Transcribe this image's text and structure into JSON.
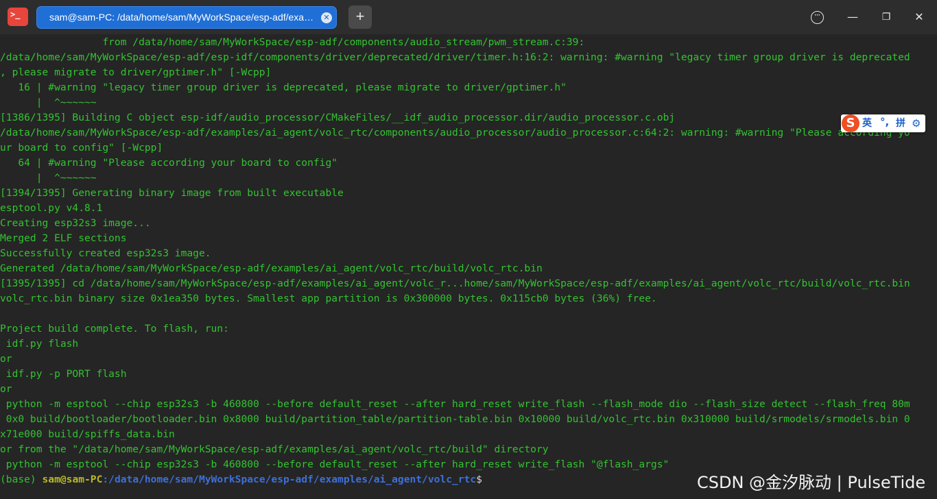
{
  "window": {
    "tab_title": "sam@sam-PC: /data/home/sam/MyWorkSpace/esp-adf/exa…",
    "app_icon_text": ">_",
    "new_tab_label": "+",
    "more_label": "···",
    "minimize_label": "—",
    "maximize_label": "❐",
    "close_label": "✕",
    "icons": {
      "app": "terminal-icon",
      "tab_close": "close-icon",
      "new_tab": "plus-icon",
      "more": "more-icon",
      "minimize": "minimize-icon",
      "maximize": "maximize-icon",
      "close": "close-icon"
    },
    "colors": {
      "tab": "#1f6fd6",
      "terminal_text": "#33c331",
      "prompt_user": "#b7b928",
      "prompt_path": "#3d6fd9"
    }
  },
  "terminal": {
    "lines": [
      "                 from /data/home/sam/MyWorkSpace/esp-adf/components/audio_stream/pwm_stream.c:39:",
      "/data/home/sam/MyWorkSpace/esp-adf/esp-idf/components/driver/deprecated/driver/timer.h:16:2: warning: #warning \"legacy timer group driver is deprecated",
      ", please migrate to driver/gptimer.h\" [-Wcpp]",
      "   16 | #warning \"legacy timer group driver is deprecated, please migrate to driver/gptimer.h\"",
      "      |  ^~~~~~~",
      "[1386/1395] Building C object esp-idf/audio_processor/CMakeFiles/__idf_audio_processor.dir/audio_processor.c.obj",
      "/data/home/sam/MyWorkSpace/esp-adf/examples/ai_agent/volc_rtc/components/audio_processor/audio_processor.c:64:2: warning: #warning \"Please according yo",
      "ur board to config\" [-Wcpp]",
      "   64 | #warning \"Please according your board to config\"",
      "      |  ^~~~~~~",
      "[1394/1395] Generating binary image from built executable",
      "esptool.py v4.8.1",
      "Creating esp32s3 image...",
      "Merged 2 ELF sections",
      "Successfully created esp32s3 image.",
      "Generated /data/home/sam/MyWorkSpace/esp-adf/examples/ai_agent/volc_rtc/build/volc_rtc.bin",
      "[1395/1395] cd /data/home/sam/MyWorkSpace/esp-adf/examples/ai_agent/volc_r...home/sam/MyWorkSpace/esp-adf/examples/ai_agent/volc_rtc/build/volc_rtc.bin",
      "volc_rtc.bin binary size 0x1ea350 bytes. Smallest app partition is 0x300000 bytes. 0x115cb0 bytes (36%) free.",
      "",
      "Project build complete. To flash, run:",
      " idf.py flash",
      "or",
      " idf.py -p PORT flash",
      "or",
      " python -m esptool --chip esp32s3 -b 460800 --before default_reset --after hard_reset write_flash --flash_mode dio --flash_size detect --flash_freq 80m",
      " 0x0 build/bootloader/bootloader.bin 0x8000 build/partition_table/partition-table.bin 0x10000 build/volc_rtc.bin 0x310000 build/srmodels/srmodels.bin 0",
      "x71e000 build/spiffs_data.bin",
      "or from the \"/data/home/sam/MyWorkSpace/esp-adf/examples/ai_agent/volc_rtc/build\" directory",
      " python -m esptool --chip esp32s3 -b 460800 --before default_reset --after hard_reset write_flash \"@flash_args\""
    ],
    "prompt": {
      "env": "(base) ",
      "user_host": "sam@sam-PC",
      "path": ":/data/home/sam/MyWorkSpace/esp-adf/examples/ai_agent/volc_rtc",
      "symbol": "$"
    }
  },
  "ime": {
    "logo": "S",
    "lang": "英",
    "punct": "°,",
    "pinyin": "拼",
    "gear": "⚙",
    "icons": {
      "logo": "sogou-logo-icon",
      "settings": "gear-icon"
    }
  },
  "watermark": "CSDN @金汐脉动 | PulseTide"
}
